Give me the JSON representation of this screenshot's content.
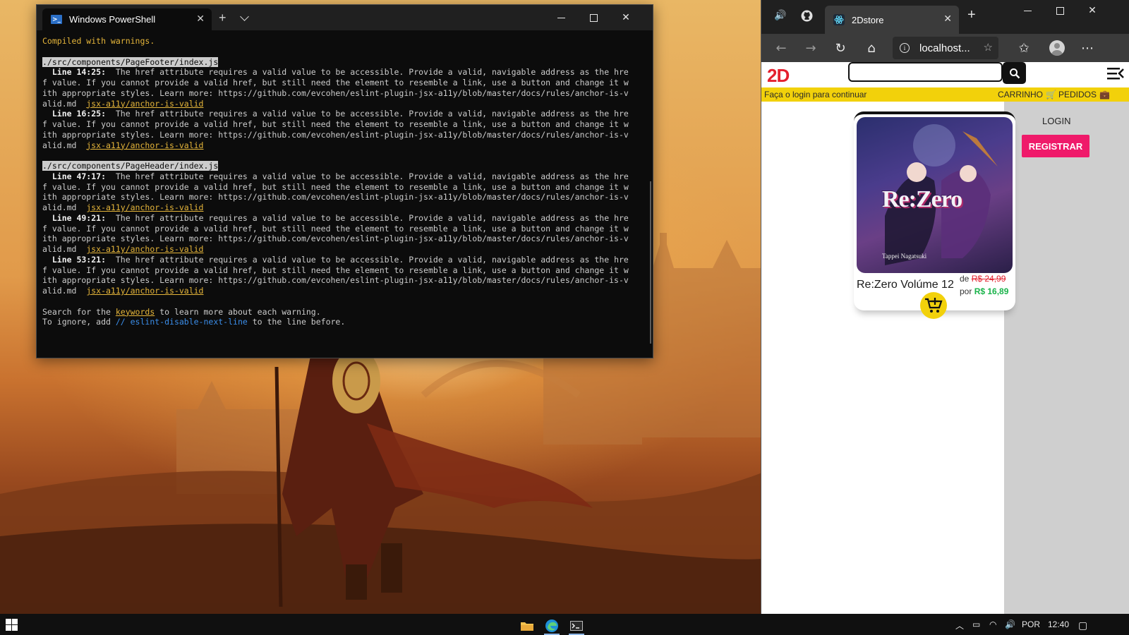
{
  "terminal": {
    "tab_title": "Windows PowerShell",
    "lines": [
      {
        "type": "plain",
        "segs": [
          {
            "c": "t-yellow",
            "t": "Compiled with warnings."
          }
        ]
      },
      {
        "type": "blank",
        "segs": []
      },
      {
        "type": "path",
        "segs": [
          {
            "c": "t-path",
            "t": "./src/components/PageFooter/index.js"
          }
        ]
      },
      {
        "type": "w",
        "segs": [
          {
            "c": "t-bold",
            "t": "  Line 14:25:"
          },
          {
            "c": "",
            "t": "  The href attribute requires a valid value to be accessible. Provide a valid, navigable address as the hre"
          }
        ]
      },
      {
        "type": "w",
        "segs": [
          {
            "c": "",
            "t": "f value. If you cannot provide a valid href, but still need the element to resemble a link, use a button and change it w"
          }
        ]
      },
      {
        "type": "w",
        "segs": [
          {
            "c": "",
            "t": "ith appropriate styles. Learn more: https://github.com/evcohen/eslint-plugin-jsx-a11y/blob/master/docs/rules/anchor-is-v"
          }
        ]
      },
      {
        "type": "w",
        "segs": [
          {
            "c": "",
            "t": "alid.md  "
          },
          {
            "c": "t-link",
            "t": "jsx-a11y/anchor-is-valid"
          }
        ]
      },
      {
        "type": "w",
        "segs": [
          {
            "c": "t-bold",
            "t": "  Line 16:25:"
          },
          {
            "c": "",
            "t": "  The href attribute requires a valid value to be accessible. Provide a valid, navigable address as the hre"
          }
        ]
      },
      {
        "type": "w",
        "segs": [
          {
            "c": "",
            "t": "f value. If you cannot provide a valid href, but still need the element to resemble a link, use a button and change it w"
          }
        ]
      },
      {
        "type": "w",
        "segs": [
          {
            "c": "",
            "t": "ith appropriate styles. Learn more: https://github.com/evcohen/eslint-plugin-jsx-a11y/blob/master/docs/rules/anchor-is-v"
          }
        ]
      },
      {
        "type": "w",
        "segs": [
          {
            "c": "",
            "t": "alid.md  "
          },
          {
            "c": "t-link",
            "t": "jsx-a11y/anchor-is-valid"
          }
        ]
      },
      {
        "type": "blank",
        "segs": []
      },
      {
        "type": "path",
        "segs": [
          {
            "c": "t-path",
            "t": "./src/components/PageHeader/index.js"
          }
        ]
      },
      {
        "type": "w",
        "segs": [
          {
            "c": "t-bold",
            "t": "  Line 47:17:"
          },
          {
            "c": "",
            "t": "  The href attribute requires a valid value to be accessible. Provide a valid, navigable address as the hre"
          }
        ]
      },
      {
        "type": "w",
        "segs": [
          {
            "c": "",
            "t": "f value. If you cannot provide a valid href, but still need the element to resemble a link, use a button and change it w"
          }
        ]
      },
      {
        "type": "w",
        "segs": [
          {
            "c": "",
            "t": "ith appropriate styles. Learn more: https://github.com/evcohen/eslint-plugin-jsx-a11y/blob/master/docs/rules/anchor-is-v"
          }
        ]
      },
      {
        "type": "w",
        "segs": [
          {
            "c": "",
            "t": "alid.md  "
          },
          {
            "c": "t-link",
            "t": "jsx-a11y/anchor-is-valid"
          }
        ]
      },
      {
        "type": "w",
        "segs": [
          {
            "c": "t-bold",
            "t": "  Line 49:21:"
          },
          {
            "c": "",
            "t": "  The href attribute requires a valid value to be accessible. Provide a valid, navigable address as the hre"
          }
        ]
      },
      {
        "type": "w",
        "segs": [
          {
            "c": "",
            "t": "f value. If you cannot provide a valid href, but still need the element to resemble a link, use a button and change it w"
          }
        ]
      },
      {
        "type": "w",
        "segs": [
          {
            "c": "",
            "t": "ith appropriate styles. Learn more: https://github.com/evcohen/eslint-plugin-jsx-a11y/blob/master/docs/rules/anchor-is-v"
          }
        ]
      },
      {
        "type": "w",
        "segs": [
          {
            "c": "",
            "t": "alid.md  "
          },
          {
            "c": "t-link",
            "t": "jsx-a11y/anchor-is-valid"
          }
        ]
      },
      {
        "type": "w",
        "segs": [
          {
            "c": "t-bold",
            "t": "  Line 53:21:"
          },
          {
            "c": "",
            "t": "  The href attribute requires a valid value to be accessible. Provide a valid, navigable address as the hre"
          }
        ]
      },
      {
        "type": "w",
        "segs": [
          {
            "c": "",
            "t": "f value. If you cannot provide a valid href, but still need the element to resemble a link, use a button and change it w"
          }
        ]
      },
      {
        "type": "w",
        "segs": [
          {
            "c": "",
            "t": "ith appropriate styles. Learn more: https://github.com/evcohen/eslint-plugin-jsx-a11y/blob/master/docs/rules/anchor-is-v"
          }
        ]
      },
      {
        "type": "w",
        "segs": [
          {
            "c": "",
            "t": "alid.md  "
          },
          {
            "c": "t-link",
            "t": "jsx-a11y/anchor-is-valid"
          }
        ]
      },
      {
        "type": "blank",
        "segs": []
      },
      {
        "type": "plain",
        "segs": [
          {
            "c": "",
            "t": "Search for the "
          },
          {
            "c": "t-link",
            "t": "keywords"
          },
          {
            "c": "",
            "t": " to learn more about each warning."
          }
        ]
      },
      {
        "type": "plain",
        "segs": [
          {
            "c": "",
            "t": "To ignore, add "
          },
          {
            "c": "t-blue",
            "t": "// eslint-disable-next-line"
          },
          {
            "c": "",
            "t": " to the line before."
          }
        ]
      }
    ]
  },
  "browser": {
    "tab_title": "2Dstore",
    "url": "localhost...",
    "icons": {
      "speaker": "speaker-icon",
      "github": "github-icon",
      "react": "react-icon"
    }
  },
  "site": {
    "logo": "2D",
    "search_placeholder": "",
    "login_prompt": "Faça o login para continuar",
    "cart_label": "CARRINHO",
    "orders_label": "PEDIDOS",
    "login_link": "LOGIN",
    "register_label": "REGISTRAR",
    "product": {
      "title": "Re:Zero Volúme 12",
      "old_price_prefix": "de",
      "old_price": "R$ 24,99",
      "new_price_prefix": "por",
      "new_price": "R$ 16,89",
      "cover_title": "Re:Zero",
      "cover_author": "Tappei Nagatsuki"
    },
    "colors": {
      "brand_red": "#e4202e",
      "strip_yellow": "#f2d10b",
      "register_pink": "#ef1a6a",
      "price_green": "#19b34a"
    }
  },
  "taskbar": {
    "lang": "POR",
    "time": "12:40"
  }
}
